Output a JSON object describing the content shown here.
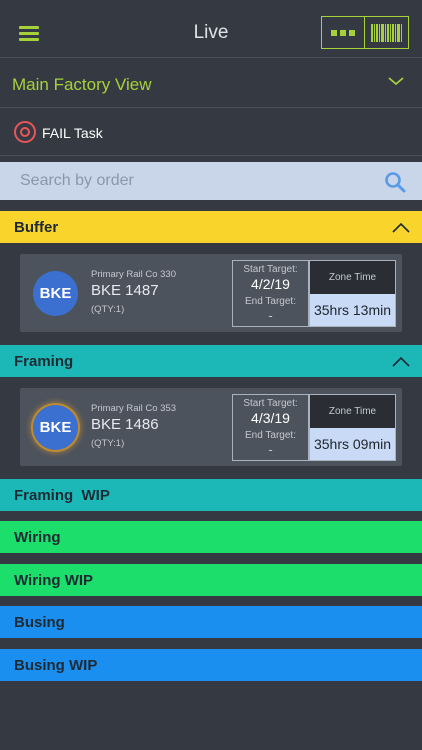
{
  "header": {
    "title": "Live",
    "menu_icon": "hamburger-menu-icon",
    "actions": [
      "more-dots-icon",
      "barcode-icon"
    ],
    "accent_color": "#a6d13a"
  },
  "factory_selector": {
    "label": "Main Factory View",
    "icon": "chevron-down-icon"
  },
  "fail_filter": {
    "label": "FAIL Task",
    "icon": "target-icon",
    "color": "#e8565a"
  },
  "search": {
    "placeholder": "Search by order",
    "icon": "search-icon"
  },
  "sections": [
    {
      "label": "Buffer",
      "color": "#f9d42b",
      "expanded": true
    },
    {
      "label": "Framing",
      "color": "#1cb8b8",
      "expanded": true
    },
    {
      "label": "Framing  WIP",
      "color": "#1cb8b8",
      "expanded": false
    },
    {
      "label": "Wiring",
      "color": "#1bdf6a",
      "expanded": false
    },
    {
      "label": "Wiring WIP",
      "color": "#1bdf6a",
      "expanded": false
    },
    {
      "label": "Busing",
      "color": "#1a8ff0",
      "expanded": false
    },
    {
      "label": "Busing WIP",
      "color": "#1a8ff0",
      "expanded": false
    }
  ],
  "cards": [
    {
      "section": "Buffer",
      "avatar": "BKE",
      "customer": "Primary Rail Co 330",
      "order": "BKE 1487",
      "qty": "(QTY:1)",
      "start_label": "Start Target:",
      "start_value": "4/2/19",
      "end_label": "End Target:",
      "end_value": "-",
      "zone_label": "Zone Time",
      "zone_value": "35hrs 13min"
    },
    {
      "section": "Framing",
      "avatar": "BKE",
      "customer": "Primary Rail Co 353",
      "order": "BKE 1486",
      "qty": "(QTY:1)",
      "start_label": "Start Target:",
      "start_value": "4/3/19",
      "end_label": "End Target:",
      "end_value": "-",
      "zone_label": "Zone Time",
      "zone_value": "35hrs 09min"
    }
  ]
}
